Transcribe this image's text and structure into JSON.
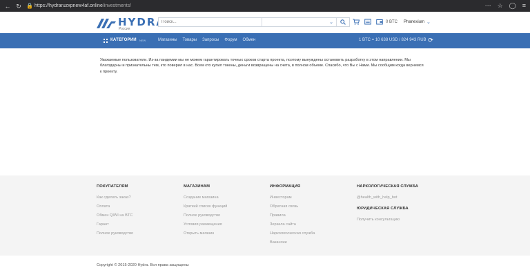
{
  "browser": {
    "url_domain": "https://hydraruzxpnew4af.online",
    "url_path": "/investments/",
    "icons": [
      "back-icon",
      "reload-icon",
      "lock-icon",
      "more-icon",
      "star-icon",
      "shield-icon",
      "menu-icon"
    ]
  },
  "header": {
    "logo_text": "HYDRA",
    "logo_subtitle": "Россия",
    "search": {
      "placeholder": "Поиск..."
    },
    "balance": "0 BTC",
    "username": "Phanexium",
    "colors": {
      "brand": "#3a6fb4"
    }
  },
  "nav": {
    "categories_label": "КАТЕГОРИИ",
    "categories_badge": "NEW",
    "links": [
      "Магазины",
      "Товары",
      "Запросы",
      "Форум",
      "Обмен"
    ],
    "rate": "1 BTC = 10 638 USD / 824 943 RUB"
  },
  "main": {
    "notice": "Уважаемые пользователи. Из-за пандемии мы не можем гарантировать точных сроков старта проекта, поэтому вынуждены остановить разработку в этом направлении. Мы благодарны и признательны тем, кто поверил в нас. Всем кто купил токены, деньги возвращены на счета, в полном объеме. Спасибо, что Вы с Нами. Мы сообщим когда вернемся к проекту."
  },
  "footer": {
    "columns": [
      {
        "title": "ПОКУПАТЕЛЯМ",
        "links": [
          "Как сделать заказ?",
          "Оплата",
          "Обмен QIWI на BTC",
          "Гарант",
          "Полное руководство"
        ]
      },
      {
        "title": "МАГАЗИНАМ",
        "links": [
          "Создание магазина",
          "Краткий список функций",
          "Полное руководство",
          "Условия размещения",
          "Открыть магазин"
        ]
      },
      {
        "title": "ИНФОРМАЦИЯ",
        "links": [
          "Инвесторам",
          "Обратная связь",
          "Правила",
          "Зеркала сайта",
          "Наркологическая служба",
          "Вакансии"
        ]
      },
      {
        "title": "НАРКОЛОГИЧЕСКАЯ СЛУЖБА",
        "links": [
          "@health_with_help_bot"
        ],
        "title2": "ЮРИДИЧЕСКАЯ СЛУЖБА",
        "links2": [
          "Получить консультацию"
        ]
      }
    ],
    "copyright": "Copyright © 2015-2020 Hydra. Вся права защищены"
  }
}
